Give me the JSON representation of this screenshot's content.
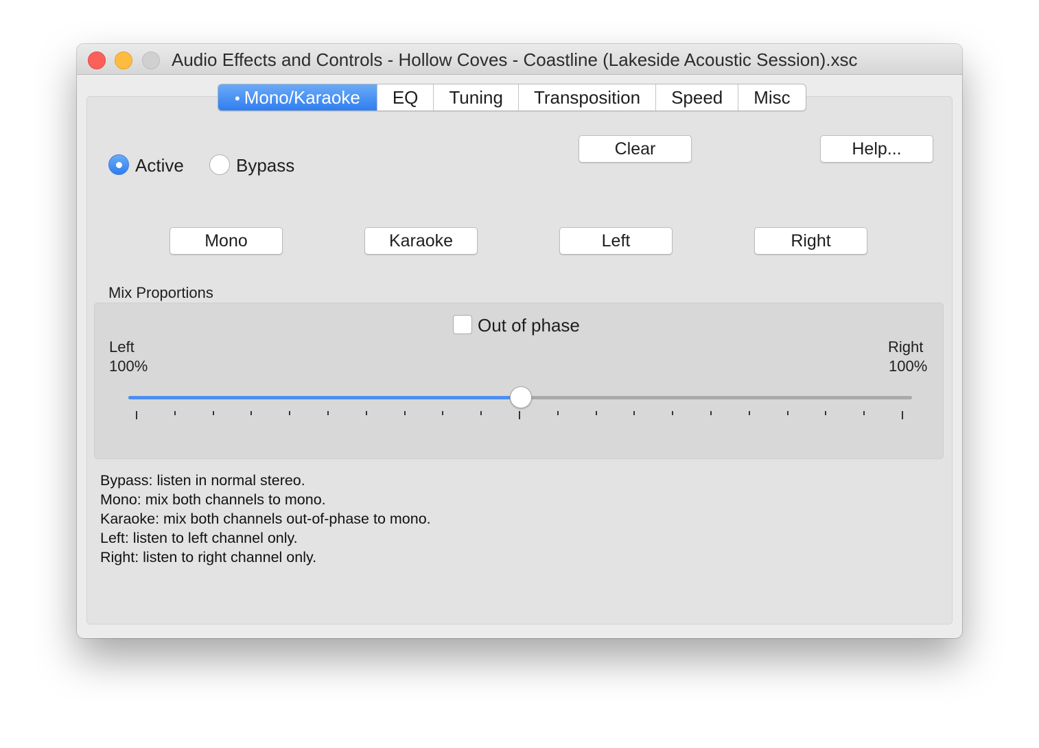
{
  "window": {
    "title": "Audio Effects and Controls - Hollow Coves - Coastline (Lakeside Acoustic Session).xsc"
  },
  "tabs": [
    {
      "label": "Mono/Karaoke",
      "active": true
    },
    {
      "label": "EQ",
      "active": false
    },
    {
      "label": "Tuning",
      "active": false
    },
    {
      "label": "Transposition",
      "active": false
    },
    {
      "label": "Speed",
      "active": false
    },
    {
      "label": "Misc",
      "active": false
    }
  ],
  "mode": {
    "active_label": "Active",
    "bypass_label": "Bypass",
    "selected": "Active"
  },
  "buttons": {
    "clear": "Clear",
    "help": "Help...",
    "mono": "Mono",
    "karaoke": "Karaoke",
    "left": "Left",
    "right": "Right"
  },
  "mix": {
    "section_label": "Mix Proportions",
    "out_of_phase_label": "Out of phase",
    "out_of_phase_checked": false,
    "left_label": "Left",
    "left_value": "100%",
    "right_label": "Right",
    "right_value": "100%",
    "slider_value": 0.5,
    "tick_count": 21
  },
  "help_lines": [
    "Bypass: listen in normal stereo.",
    "Mono: mix both channels to mono.",
    "Karaoke: mix both channels out-of-phase to mono.",
    "Left: listen to left channel only.",
    "Right: listen to right channel only."
  ],
  "colors": {
    "accent": "#2f7ef0",
    "close": "#fc605b",
    "minimize": "#fdbc40",
    "zoom": "#d0d0d0"
  }
}
